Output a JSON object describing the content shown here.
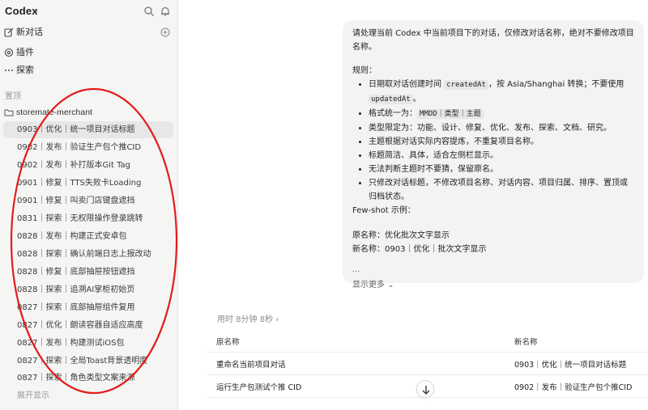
{
  "app": {
    "title": "Codex",
    "accent": "#1f1f1f",
    "annotation_color": "#e11d1d"
  },
  "sidebar": {
    "nav": [
      {
        "label": "新对话",
        "icon": "new-chat-icon"
      },
      {
        "label": "插件",
        "icon": "plugin-icon"
      },
      {
        "label": "探索",
        "icon": "more-dots-icon"
      }
    ],
    "section_label": "置顶",
    "project": "storemate-merchant",
    "threads": [
      "0903｜优化｜统一项目对话标题",
      "0902｜发布｜验证生产包个推CID",
      "0902｜发布｜补打版本Git Tag",
      "0901｜修复｜TTS失败卡Loading",
      "0901｜修复｜叫卖门店键盘遮挡",
      "0831｜探索｜无权限操作登录跳转",
      "0828｜发布｜构建正式安卓包",
      "0828｜探索｜确认前端日志上报改动",
      "0828｜修复｜底部抽屉按钮遮挡",
      "0828｜探索｜追溯AI掌柜初始页",
      "0827｜探索｜底部抽屉组件复用",
      "0827｜优化｜朗读容器自适应高度",
      "0827｜发布｜构建测试iOS包",
      "0827｜探索｜全局Toast背景透明度",
      "0827｜探索｜角色类型文案来源"
    ],
    "show_more": "展开显示"
  },
  "message": {
    "intro": "请处理当前 Codex 中当前项目下的对话，仅修改对话名称，绝对不要修改项目名称。",
    "rules_title": "规则：",
    "rule1_a": "日期取对话创建时间 ",
    "rule1_code1": "createdAt",
    "rule1_b": "，按 Asia/Shanghai 转换；不要使用",
    "rule1_code2": "updatedAt",
    "rule1_c": "。",
    "rule2_a": "格式统一为：",
    "rule2_code": "MMDD｜类型｜主题",
    "rule3": "类型限定为：功能、设计、修复、优化、发布、探索、文档、研究。",
    "rule4": "主题根据对话实际内容提炼，不重复项目名称。",
    "rule5": "标题简洁、具体，适合左侧栏显示。",
    "rule6": "无法判断主题时不要猜，保留原名。",
    "rule7": "只修改对话标题，不修改项目名称、对话内容、项目归属、排序、置顶或归档状态。",
    "fewshot": "Few-shot 示例：",
    "ex_orig": "原名称：优化批次文字显示",
    "ex_new": "新名称：0903｜优化｜批次文字显示",
    "ellipsis": "...",
    "show_more": "显示更多"
  },
  "result": {
    "elapsed": "用时 8分钟 8秒",
    "columns": [
      "原名称",
      "新名称"
    ],
    "rows": [
      [
        "重命名当前项目对话",
        "0903｜优化｜统一项目对话标题"
      ],
      [
        "运行生产包测试个推 CID",
        "0902｜发布｜验证生产包个推CID"
      ]
    ]
  }
}
